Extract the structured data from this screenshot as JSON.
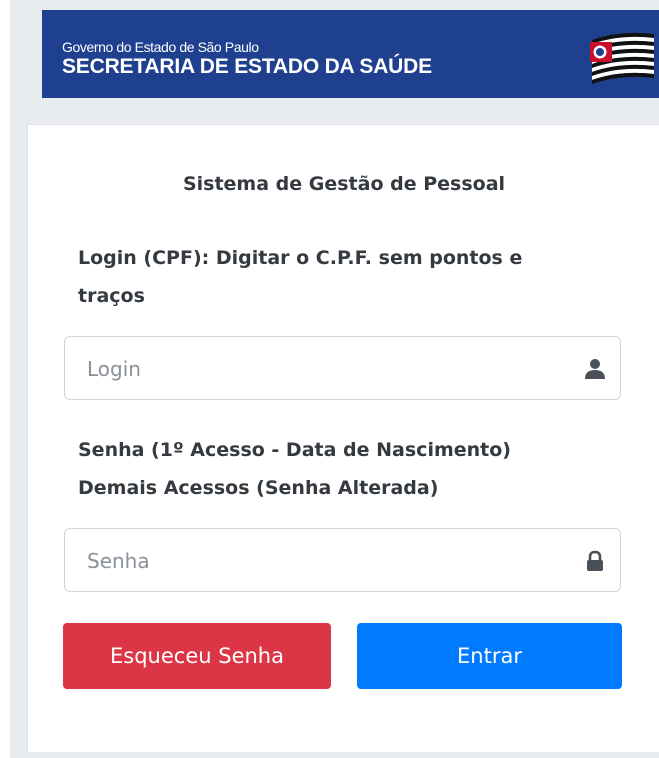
{
  "banner": {
    "line1": "Governo do Estado de São Paulo",
    "line2": "SECRETARIA DE ESTADO DA SAÚDE",
    "bg_color": "#1f3f8f"
  },
  "form": {
    "title": "Sistema de Gestão de Pessoal",
    "login_label_line1": "Login (CPF): Digitar o C.P.F. sem pontos e",
    "login_label_line2": "traços",
    "login_placeholder": "Login",
    "login_icon": "user-icon",
    "password_label_line1": "Senha (1º Acesso - Data de Nascimento)",
    "password_label_line2": "Demais Acessos (Senha Alterada)",
    "password_placeholder": "Senha",
    "password_icon": "lock-icon"
  },
  "buttons": {
    "forgot_label": "Esqueceu Senha",
    "forgot_color": "#dc3545",
    "submit_label": "Entrar",
    "submit_color": "#007bff"
  }
}
